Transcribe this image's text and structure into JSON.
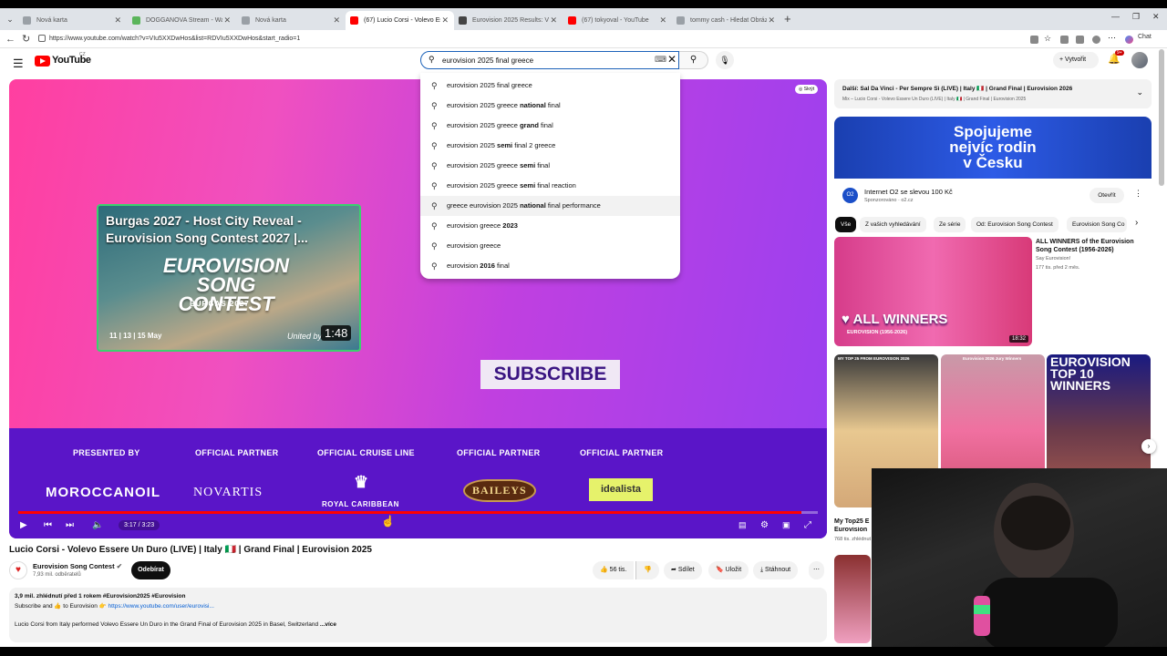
{
  "browser": {
    "tabs": [
      {
        "title": "Nová karta",
        "color": "#9aa0a6"
      },
      {
        "title": "DOGGANOVA Stream - Watch Live",
        "color": "#5bb55b"
      },
      {
        "title": "Nová karta",
        "color": "#9aa0a6"
      },
      {
        "title": "(67) Lucio Corsi - Volevo Essere Un Duro",
        "color": "#ff0000"
      },
      {
        "title": "Eurovision 2025 Results: Voting & Points",
        "color": "#444444"
      },
      {
        "title": "(67) tokyoval - YouTube",
        "color": "#ff0000"
      },
      {
        "title": "tommy cash - Hledat Obrázky",
        "color": "#9aa0a6"
      }
    ],
    "url": "https://www.youtube.com/watch?v=VIu5XXDwHos&list=RDVIu5XXDwHos&start_radio=1",
    "chat_label": "Chat"
  },
  "header": {
    "logo": "YouTube",
    "logo_country": "CZ",
    "search_value": "eurovision 2025 final greece",
    "create_label": "Vytvořit",
    "notif_count": "9+"
  },
  "suggestions": [
    {
      "pre": "eurovision 2025 final greece",
      "bold": "",
      "post": ""
    },
    {
      "pre": "eurovision 2025 greece ",
      "bold": "national",
      "post": " final"
    },
    {
      "pre": "eurovision 2025 greece ",
      "bold": "grand",
      "post": " final"
    },
    {
      "pre": "eurovision 2025 ",
      "bold": "semi",
      "post": " final 2 greece"
    },
    {
      "pre": "eurovision 2025 greece ",
      "bold": "semi",
      "post": " final"
    },
    {
      "pre": "eurovision 2025 greece ",
      "bold": "semi",
      "post": " final reaction"
    },
    {
      "pre": "greece eurovision 2025 ",
      "bold": "national",
      "post": " final performance"
    },
    {
      "pre": "eurovision greece ",
      "bold": "2023",
      "post": ""
    },
    {
      "pre": "eurovision greece",
      "bold": "",
      "post": ""
    },
    {
      "pre": "eurovision ",
      "bold": "2016",
      "post": " final"
    }
  ],
  "player": {
    "hide_label": "Skrýt",
    "endcard": {
      "title": "Burgas 2027 - Host City Reveal - Eurovision Song Contest 2027 |...",
      "logo_line1": "EUROVISION",
      "logo_line2": "SONG CONTEST",
      "city": "BURGAS 2027",
      "dates": "11 | 13 | 15 May",
      "united": "United by",
      "duration": "1:48"
    },
    "subscribe_cta": "SUBSCRIBE",
    "partners": [
      {
        "label": "PRESENTED BY",
        "name": "MOROCCANOIL"
      },
      {
        "label": "OFFICIAL PARTNER",
        "name": "NOVARTIS"
      },
      {
        "label": "OFFICIAL CRUISE LINE",
        "name": "ROYAL CARIBBEAN"
      },
      {
        "label": "OFFICIAL PARTNER",
        "name": "BAILEYS"
      },
      {
        "label": "OFFICIAL PARTNER",
        "name": "idealista"
      }
    ],
    "time": "3:17 / 3:23",
    "progress": 0.98
  },
  "video": {
    "title": "Lucio Corsi - Volevo Essere Un Duro (LIVE) | Italy 🇮🇹 | Grand Final | Eurovision 2025",
    "channel": "Eurovision Song Contest",
    "subscribers": "7,93 mil. odběratelů",
    "subscribe_label": "Odebírat",
    "likes": "56 tis.",
    "share": "Sdílet",
    "save": "Uložit",
    "download": "Stáhnout",
    "desc_meta": "3,9 mil. zhlédnutí  před 1 rokem  #Eurovision2025 #Eurovision",
    "desc_line2_pre": "Subscribe and 👍 to Eurovision 👉 ",
    "desc_link": "https://www.youtube.com/user/eurovisi...",
    "desc_line3": "Lucio Corsi from Italy performed Volevo Essere Un Duro in the Grand Final of Eurovision 2025 in Basel, Switzerland",
    "desc_more": "...více"
  },
  "sidebar": {
    "next_title": "Další: Sal Da Vinci - Per Sempre Sì (LIVE) | Italy 🇮🇹 | Grand Final | Eurovision 2026",
    "next_sub": "Mix – Lucio Corsi - Volevo Essere Un Duro (LIVE) | Italy 🇮🇹 | Grand Final | Eurovision 2025",
    "ad_banner_l1": "Spojujeme",
    "ad_banner_l2": "nejvíc rodin",
    "ad_banner_l3": "v Česku",
    "ad_icon": "O2",
    "ad_title": "Internet O2 se slevou 100 Kč",
    "ad_sponsored": "Sponzorováno · o2.cz",
    "ad_open": "Otevřít",
    "chips": [
      "Vše",
      "Z vašich vyhledávání",
      "Ze série",
      "Od: Eurovision Song Contest",
      "Eurovision Song Co"
    ],
    "v1_title": "ALL WINNERS of the Eurovision Song Contest (1956-2026)",
    "v1_channel": "Say Eurovision!",
    "v1_meta": "177 tis.   před 2 měs.",
    "v1_thumb_text": "ALL WINNERS",
    "v1_thumb_sub": "EUROVISION (1956-2026)",
    "v1_duration": "18:32",
    "short1_label": "MY TOP 25 FROM EUROVISION 2026",
    "short2_label": "Eurovision 2026 Jury Winners",
    "short3_title": "EUROVISION TOP 10 WINNERS",
    "short1_title": "My Top25 E",
    "short1_title2": "Eurovision",
    "short1_views": "768 tis. zhlédnutí"
  }
}
